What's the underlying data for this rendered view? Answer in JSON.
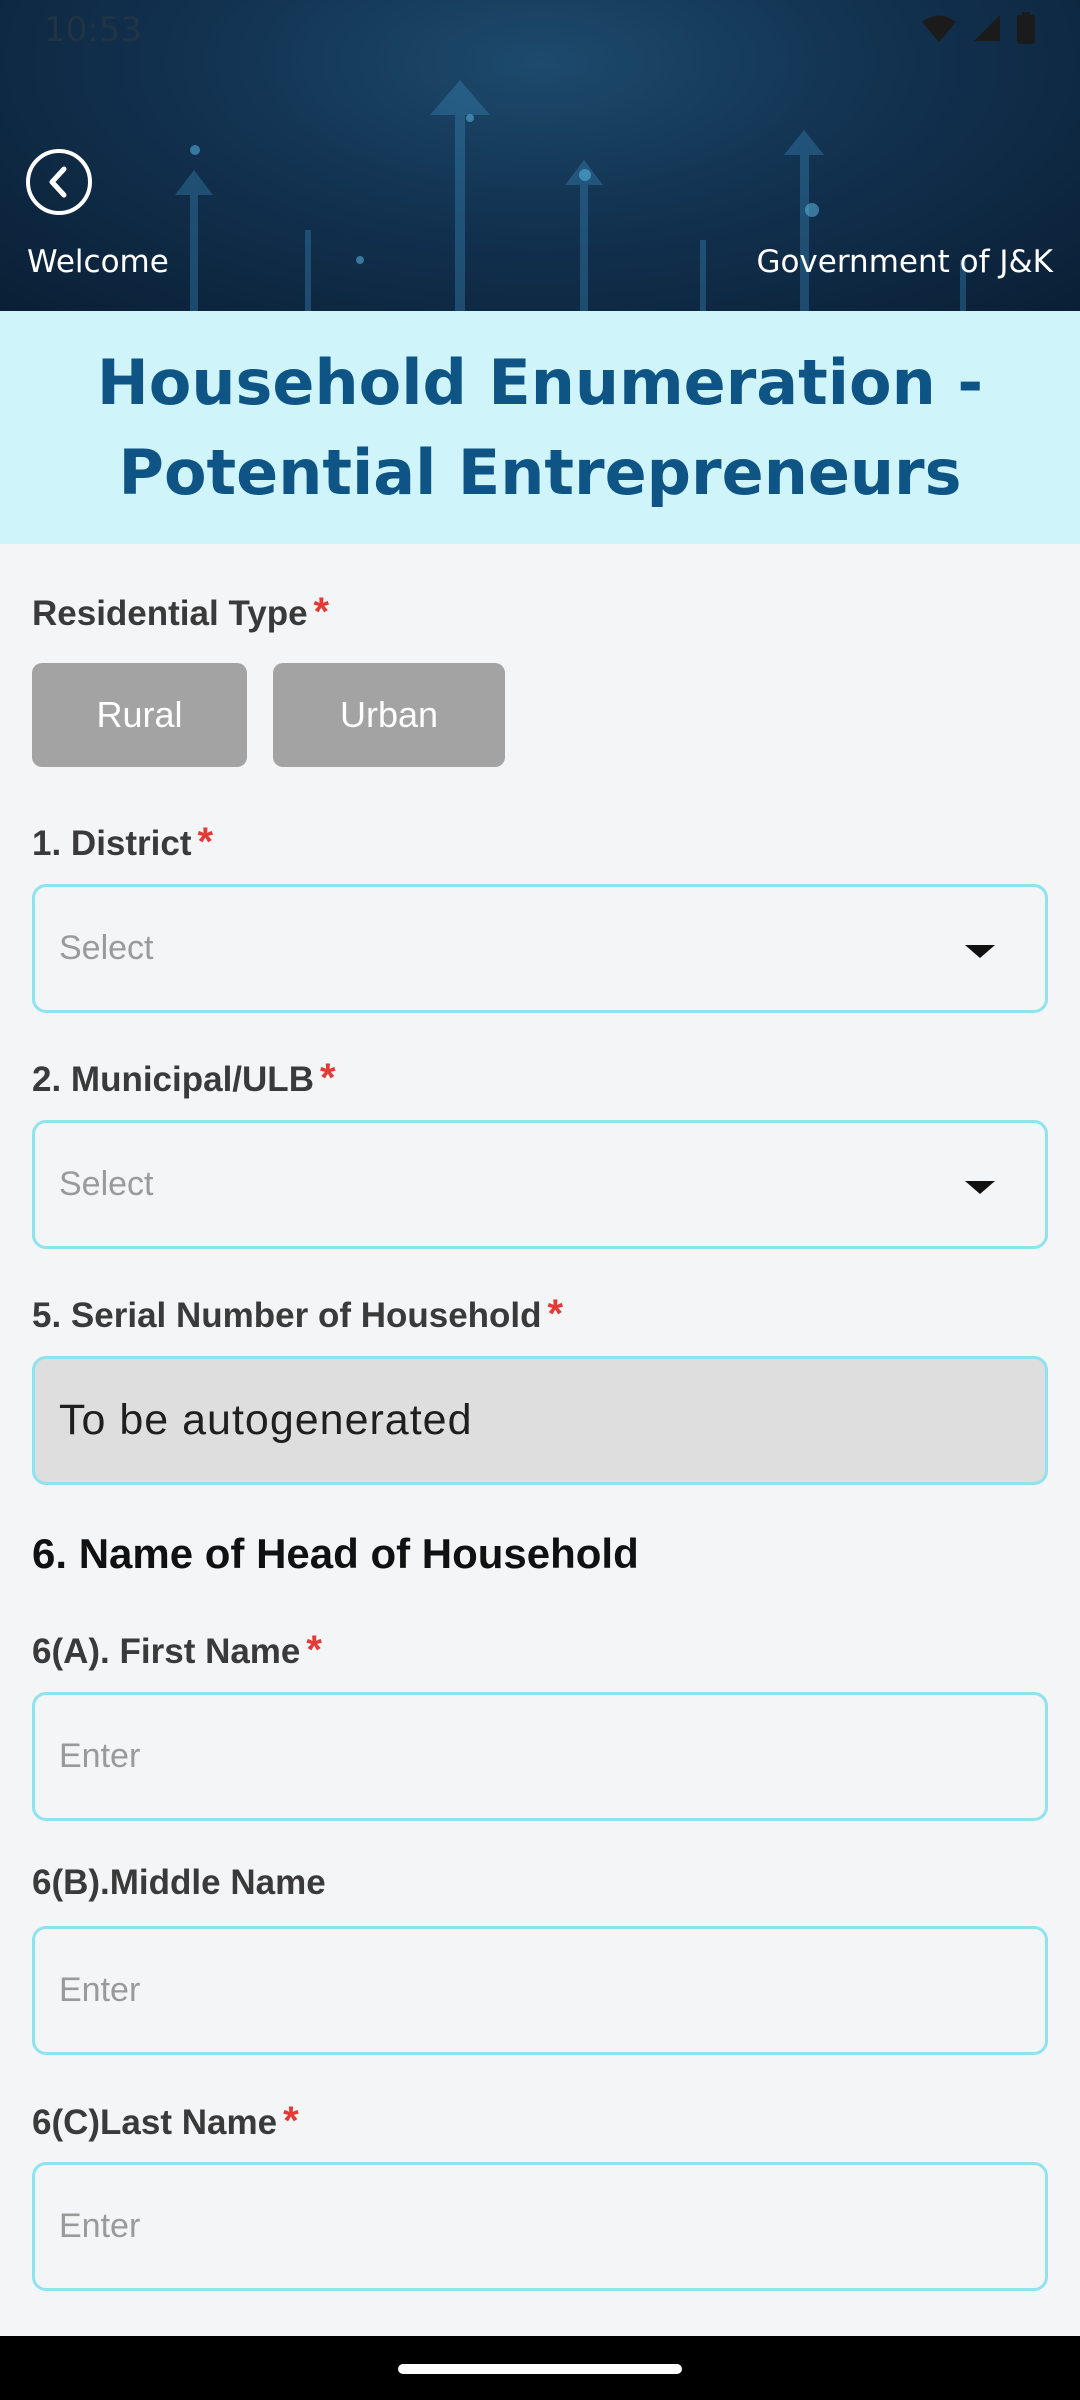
{
  "status_bar": {
    "time": "10:53"
  },
  "header": {
    "left_label": "Welcome",
    "right_label": "Government of J&K"
  },
  "title": {
    "line1": "Household Enumeration -",
    "line2": "Potential Entrepreneurs"
  },
  "residential_type": {
    "label": "Residential Type",
    "required": "*",
    "options": [
      "Rural",
      "Urban"
    ]
  },
  "district": {
    "label": "1. District",
    "required": "*",
    "placeholder": "Select"
  },
  "municipal": {
    "label": "2. Municipal/ULB",
    "required": "*",
    "placeholder": "Select"
  },
  "serial": {
    "label": "5. Serial Number of Household",
    "required": "*",
    "value": "To be autogenerated"
  },
  "head_section": {
    "title": "6. Name of Head of Household"
  },
  "first_name": {
    "label": "6(A). First Name",
    "required": "*",
    "placeholder": "Enter"
  },
  "middle_name": {
    "label": "6(B).Middle Name",
    "placeholder": "Enter"
  },
  "last_name": {
    "label": "6(C)Last Name",
    "required": "*",
    "placeholder": "Enter"
  },
  "colors": {
    "header_bg": "#123250",
    "title_band_bg": "#cff5fb",
    "title_text": "#0e5485",
    "field_border": "#8ee3ee",
    "required_mark": "#e53935",
    "toggle_bg": "#a3a3a3"
  }
}
